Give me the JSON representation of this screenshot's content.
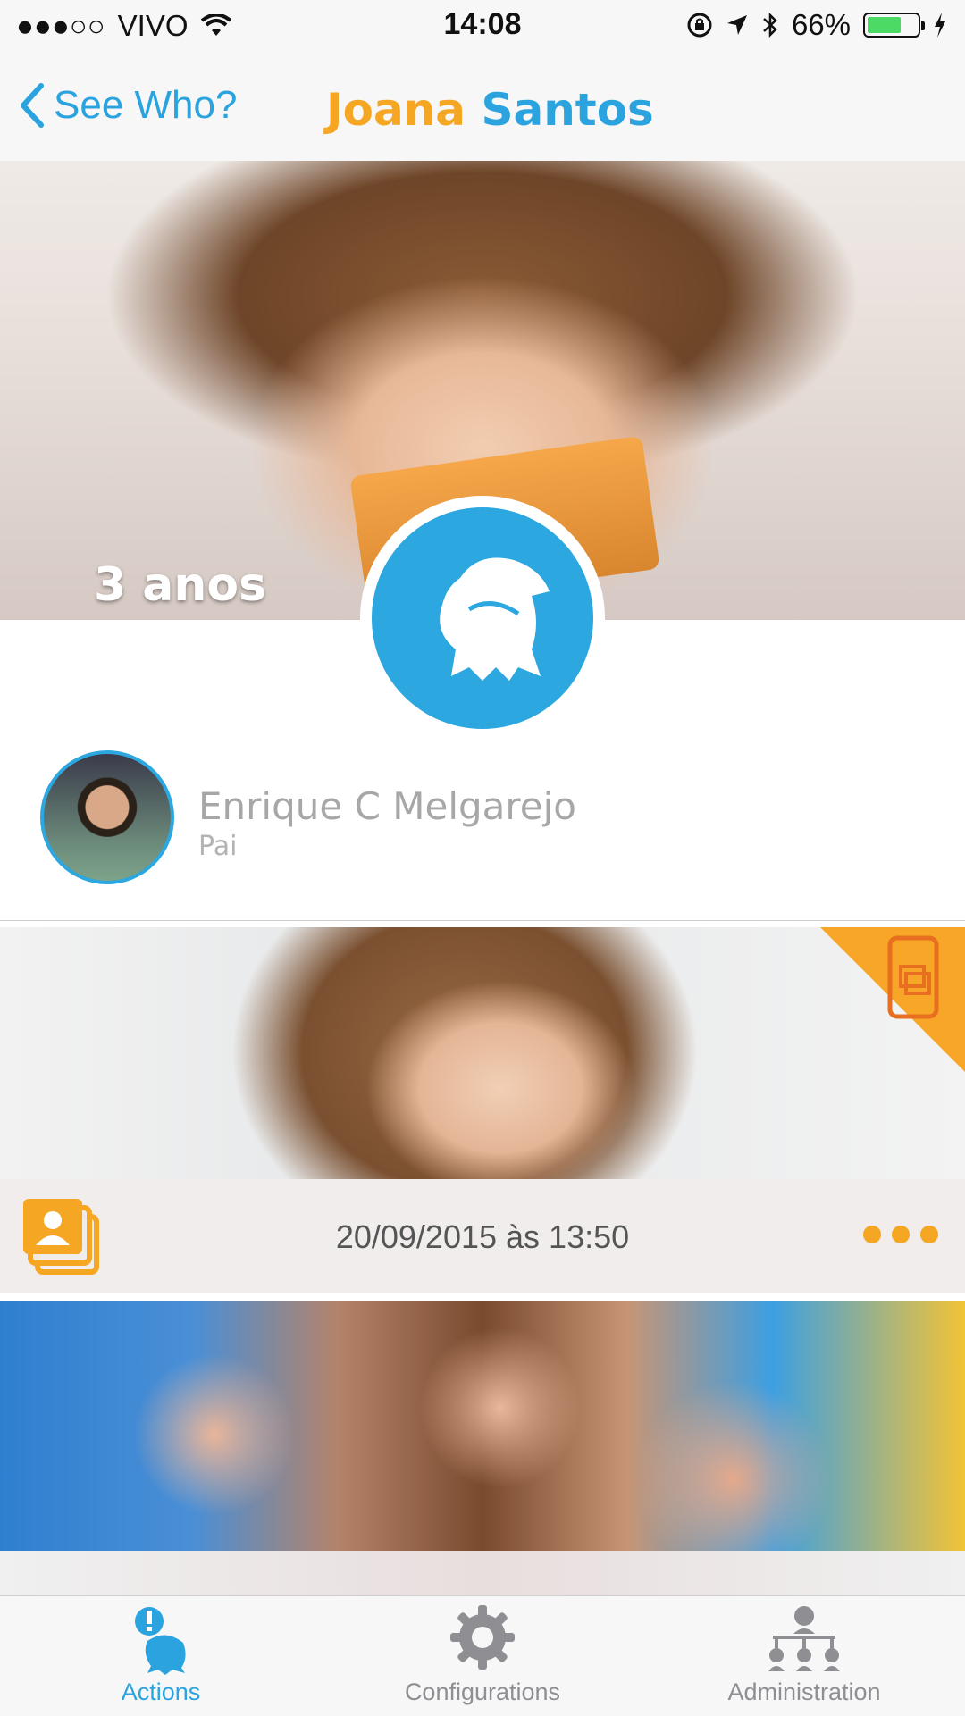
{
  "status_bar": {
    "carrier": "VIVO",
    "time": "14:08",
    "battery": "66%"
  },
  "nav": {
    "back_label": "See Who?",
    "title_first": "Joana",
    "title_last": "Santos"
  },
  "profile": {
    "age": "3 anos"
  },
  "guardian": {
    "name": "Enrique C Melgarejo",
    "relation": "Pai"
  },
  "feed": {
    "item1_timestamp": "20/09/2015 às 13:50"
  },
  "tabs": [
    {
      "label": "Actions",
      "icon": "actions-icon",
      "active": true
    },
    {
      "label": "Configurations",
      "icon": "gear-icon",
      "active": false
    },
    {
      "label": "Administration",
      "icon": "hierarchy-icon",
      "active": false
    }
  ],
  "colors": {
    "accent_blue": "#2aa3df",
    "accent_orange": "#f5a623"
  }
}
